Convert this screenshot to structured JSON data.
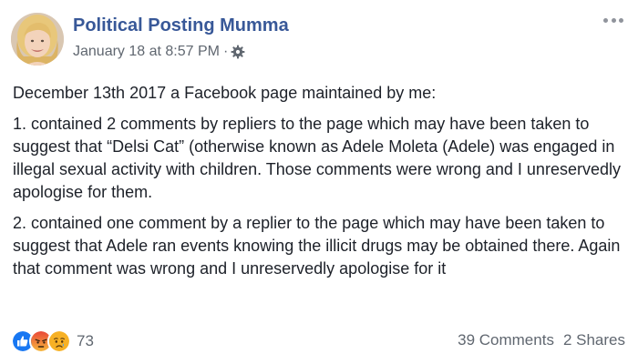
{
  "post": {
    "author": "Political Posting Mumma",
    "timestamp": "January 18 at 8:57 PM",
    "separator": "·",
    "privacy_icon": "gear-icon",
    "paragraphs": [
      "December 13th 2017 a Facebook page maintained by me:",
      "1. contained 2 comments by repliers to the page which may have been taken to suggest that “Delsi Cat” (otherwise known as Adele Moleta (Adele) was engaged in illegal sexual activity with children. Those comments were wrong and I unreservedly apologise for them.",
      "2. contained one comment by a replier to the page which may have been taken to suggest that Adele ran events knowing the illicit drugs may be obtained there. Again that comment was wrong and I unreservedly apologise for it"
    ]
  },
  "footer": {
    "reactions": [
      "like-icon",
      "angry-icon",
      "sad-icon"
    ],
    "reaction_count": "73",
    "comments": "39 Comments",
    "shares": "2 Shares"
  },
  "colors": {
    "author": "#385898",
    "meta": "#606770",
    "text": "#1d2129",
    "like": "#1877f2",
    "angry": "#e9710f",
    "sad": "#f7b125"
  }
}
